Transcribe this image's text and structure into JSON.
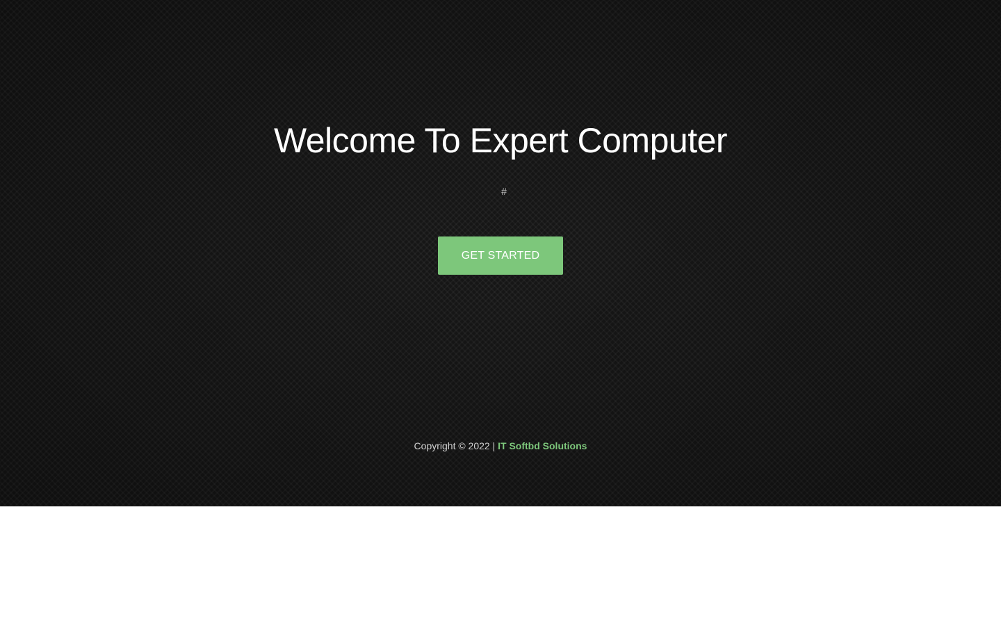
{
  "hero": {
    "title": "Welcome To Expert Computer",
    "subtitle": "#",
    "cta_label": "GET STARTED"
  },
  "footer": {
    "copyright_text": "Copyright © 2022 |",
    "brand_link": "IT Softbd Solutions"
  },
  "colors": {
    "accent": "#7dc77b",
    "background": "#171717",
    "text": "#ffffff"
  }
}
